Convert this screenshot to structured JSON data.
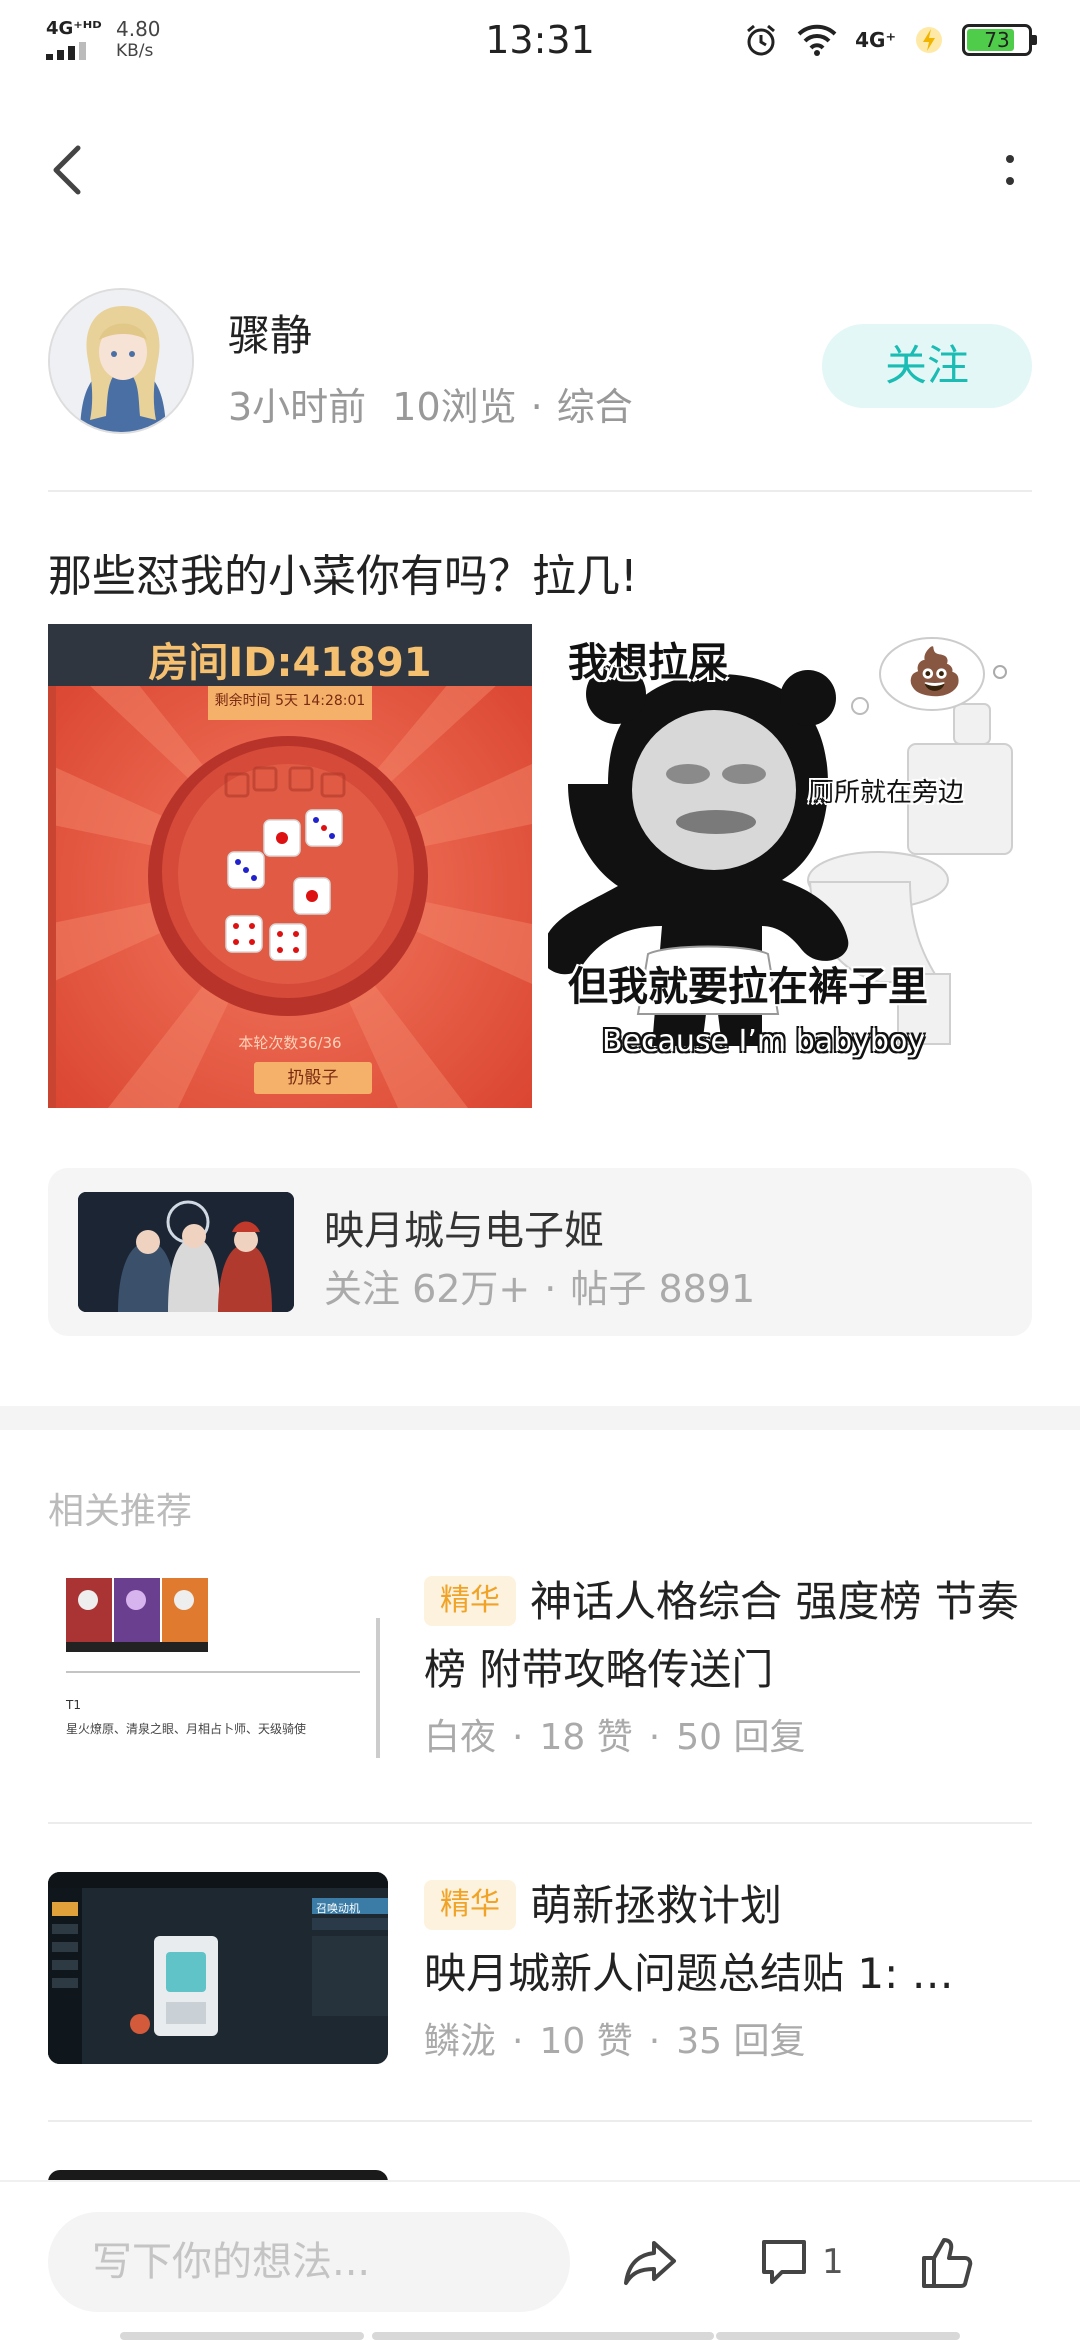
{
  "status_bar": {
    "network": "4G⁺ᴴᴰ",
    "speed_value": "4.80",
    "speed_unit": "KB/s",
    "time": "13:31",
    "network2": "4G⁺",
    "battery": "73"
  },
  "author": {
    "name": "骤静",
    "time_ago": "3小时前",
    "views": "10浏览",
    "separator": "·",
    "category": "综合",
    "follow_label": "关注"
  },
  "post": {
    "title": "那些怼我的小菜你有吗？拉几!",
    "image_left": {
      "room_id": "房间ID:41891",
      "remaining": "剩余时间 5天 14:28:01",
      "round_count": "本轮次数36/36",
      "roll_button": "扔骰子"
    },
    "image_right": {
      "text_top": "我想拉屎",
      "text_side": "厕所就在旁边",
      "text_bottom": "但我就要拉在裤子里",
      "text_english": "Because I’m babyboy",
      "emoji": "💩"
    }
  },
  "game_card": {
    "name": "映月城与电子姬",
    "followers": "关注 62万+",
    "separator": "·",
    "posts": "帖子 8891"
  },
  "recommend": {
    "section_title": "相关推荐",
    "items": [
      {
        "badge": "精华",
        "title": "神话人格综合 强度榜 节奏榜 附带攻略传送门",
        "author": "白夜",
        "likes": "18 赞",
        "replies": "50 回复",
        "separator": "·",
        "thumb_caption_title": "T1",
        "thumb_caption": "星火燎原、清泉之眼、月相占卜师、天级骑使"
      },
      {
        "badge": "精华",
        "title_line1": "萌新拯救计划",
        "title_line2": "映月城新人问题总结贴 1: …",
        "author": "鳞泷",
        "likes": "10 赞",
        "replies": "35 回复",
        "separator": "·",
        "thumb_caption": "召唤动机"
      }
    ]
  },
  "bottom_bar": {
    "input_placeholder": "写下你的想法...",
    "comment_count": "1"
  },
  "colors": {
    "accent": "#1bbcb4",
    "follow_bg": "#e2f7f6",
    "badge_text": "#f0a326",
    "badge_bg": "#fdf2de",
    "battery": "#4fcd4a"
  },
  "icons": [
    "back-arrow-icon",
    "more-vertical-icon",
    "share-icon",
    "comment-icon",
    "like-thumb-icon",
    "alarm-icon",
    "wifi-icon",
    "charging-icon"
  ]
}
